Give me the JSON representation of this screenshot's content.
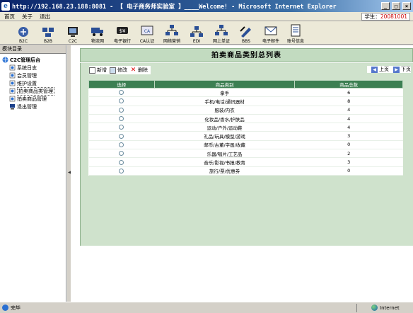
{
  "window": {
    "title": "http://192.168.23.188:8081 - 【 电子商务师实验室 】____Welcome! - Microsoft Internet Explorer",
    "controls": [
      "_",
      "□",
      "×"
    ]
  },
  "menubar": {
    "items": [
      "首页",
      "关于",
      "退出"
    ],
    "student_label": "学生：",
    "student_id": "20081001"
  },
  "toolbar": {
    "items": [
      {
        "label": "B2C",
        "icon": "b2c-icon"
      },
      {
        "label": "B2B",
        "icon": "b2b-icon"
      },
      {
        "label": "C2C",
        "icon": "c2c-icon"
      },
      {
        "label": "物流网",
        "icon": "logistics-icon"
      },
      {
        "label": "电子银行",
        "icon": "ebank-icon"
      },
      {
        "label": "CA认证",
        "icon": "ca-icon"
      },
      {
        "label": "网络营销",
        "icon": "marketing-icon"
      },
      {
        "label": "EDI",
        "icon": "edi-icon"
      },
      {
        "label": "网上单证",
        "icon": "documents-icon"
      },
      {
        "label": "BBS",
        "icon": "bbs-icon"
      },
      {
        "label": "电子邮件",
        "icon": "email-icon"
      },
      {
        "label": "账号信息",
        "icon": "account-icon"
      }
    ]
  },
  "sidebar": {
    "header": "模块目录",
    "root": "C2C管理后台",
    "items": [
      "系统日志",
      "会员管理",
      "维护设置",
      "拍卖商品类管理",
      "拍卖商品管理",
      "退出管理"
    ]
  },
  "main": {
    "title": "拍卖商品类别总列表",
    "actions": {
      "new": "新增",
      "edit": "修改",
      "delete": "删除"
    },
    "pager": {
      "prev": "上页",
      "next": "下页"
    },
    "columns": [
      "选择",
      "商品类别",
      "商品总数"
    ],
    "rows": [
      {
        "category": "拿手",
        "count": "6"
      },
      {
        "category": "手机/电话/通讯器材",
        "count": "8"
      },
      {
        "category": "服装/内衣",
        "count": "4"
      },
      {
        "category": "化妆品/香水/护肤品",
        "count": "4"
      },
      {
        "category": "运动/户外/运动鞋",
        "count": "4"
      },
      {
        "category": "礼品/玩具/模型/游戏",
        "count": "3"
      },
      {
        "category": "邮币/古董/字画/收藏",
        "count": "0"
      },
      {
        "category": "乐器/唱片/工艺品",
        "count": "2"
      },
      {
        "category": "音乐/影视/书报/教育",
        "count": "3"
      },
      {
        "category": "旅行/票/优惠券",
        "count": "0"
      }
    ]
  },
  "statusbar": {
    "status": "完毕",
    "zone": "Internet"
  },
  "colors": {
    "header_green": "#c2dbc0",
    "grid_header": "#3c7f52",
    "title_blue": "#0a246a"
  }
}
